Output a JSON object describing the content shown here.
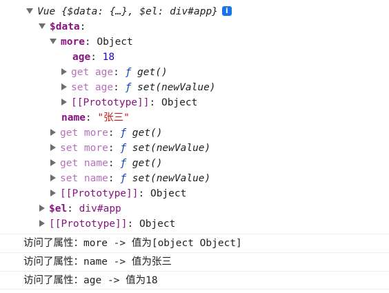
{
  "tree": {
    "root": {
      "type_name": "Vue",
      "preview": "{$data: {…}, $el: div#app}",
      "info_glyph": "i"
    },
    "data_key": "$data",
    "more_key": "more",
    "more_value": "Object",
    "age_key": "age",
    "age_value": "18",
    "get_age_key": "get age",
    "get_age_value": "get()",
    "set_age_key": "set age",
    "set_age_value": "set(newValue)",
    "more_proto_key": "[[Prototype]]",
    "more_proto_value": "Object",
    "name_key": "name",
    "name_value": "\"张三\"",
    "get_more_key": "get more",
    "get_more_value": "get()",
    "set_more_key": "set more",
    "set_more_value": "set(newValue)",
    "get_name_key": "get name",
    "get_name_value": "get()",
    "set_name_key": "set name",
    "set_name_value": "set(newValue)",
    "data_proto_key": "[[Prototype]]",
    "data_proto_value": "Object",
    "el_key": "$el",
    "el_value": "div#app",
    "root_proto_key": "[[Prototype]]",
    "root_proto_value": "Object",
    "f_symbol": "ƒ"
  },
  "logs": [
    "访问了属性：more -> 值为[object Object]",
    "访问了属性：name -> 值为张三",
    "访问了属性：age -> 值为18"
  ]
}
